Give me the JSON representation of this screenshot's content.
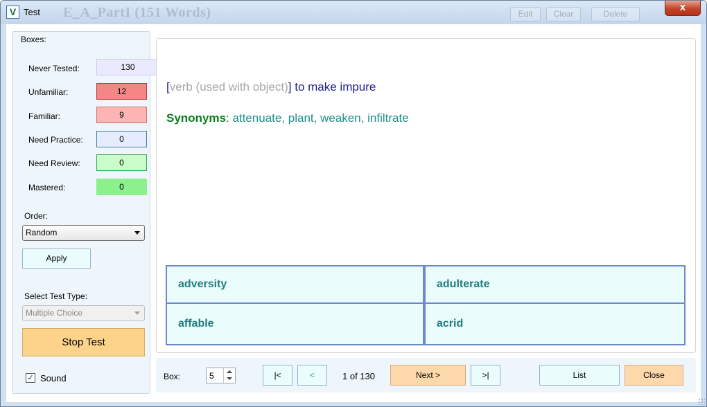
{
  "window": {
    "title": "Test",
    "icon_letter": "V",
    "background_title": "E_A_PartI (151 Words)",
    "background_buttons": [
      "Edit",
      "Clear",
      "Delete"
    ],
    "close_glyph": "x"
  },
  "boxes": {
    "caption": "Boxes:",
    "rows": [
      {
        "label": "Never Tested:",
        "value": "130",
        "fill": "#e9eafd",
        "border": "#c9c9e6"
      },
      {
        "label": "Unfamiliar:",
        "value": "12",
        "fill": "#f48686",
        "border": "#b23c3c"
      },
      {
        "label": "Familiar:",
        "value": "9",
        "fill": "#fcb4b4",
        "border": "#d46f6f"
      },
      {
        "label": "Need Practice:",
        "value": "0",
        "fill": "#e6ecfd",
        "border": "#3d7fa6"
      },
      {
        "label": "Need Review:",
        "value": "0",
        "fill": "#c9fcc9",
        "border": "#3aa55a"
      },
      {
        "label": "Mastered:",
        "value": "0",
        "fill": "#8cf08c",
        "border": "#8cf08c"
      }
    ]
  },
  "order": {
    "label": "Order:",
    "selected": "Random",
    "apply_label": "Apply"
  },
  "test_type": {
    "label": "Select Test Type:",
    "selected": "Multiple Choice",
    "stop_label": "Stop Test"
  },
  "sound": {
    "label": "Sound",
    "checked": true,
    "check_glyph": "✓"
  },
  "question": {
    "open_bracket": "[",
    "part_of_speech": "verb (used with object)",
    "close_bracket": "]",
    "definition": " to make impure",
    "synonyms_label": "Synonyms",
    "synonyms_colon": ":",
    "synonyms": " attenuate, plant, weaken, infiltrate"
  },
  "choices": [
    "adversity",
    "adulterate",
    "affable",
    "acrid"
  ],
  "nav": {
    "box_label": "Box:",
    "box_value": "5",
    "first_label": "|<",
    "prev_label": "<",
    "page_info": "1 of 130",
    "next_label": "Next >",
    "last_label": ">|",
    "list_label": "List",
    "close_label": "Close"
  }
}
